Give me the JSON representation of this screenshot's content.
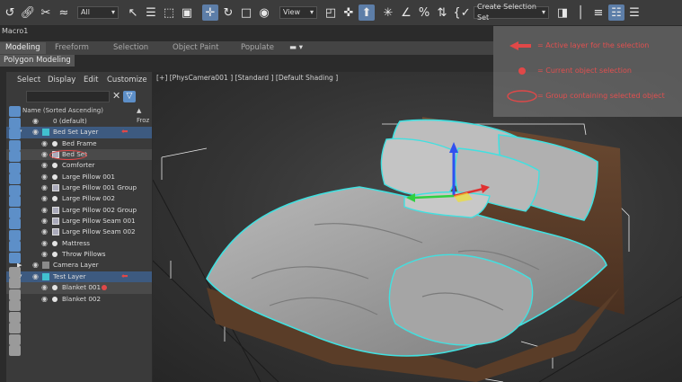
{
  "toolbar": {
    "filter_dropdown": "All",
    "view_dropdown": "View",
    "selection_set_dropdown": "Create Selection Set",
    "icons": [
      "undo-icon",
      "link-icon",
      "unlink-icon",
      "bind-spacewarp-icon",
      "select-object-icon",
      "select-by-name-icon",
      "rect-selection-icon",
      "window-crossing-icon",
      "move-icon",
      "rotate-icon",
      "scale-icon",
      "place-icon",
      "pivot-icon",
      "select-manipulate-icon",
      "keyboard-shortcut-icon",
      "snaps-icon",
      "angle-snap-icon",
      "percent-snap-icon",
      "spinner-snap-icon",
      "edit-named-sets-icon",
      "mirror-icon",
      "align-icon",
      "toggle-scene-explorer-icon",
      "toggle-layer-explorer-icon"
    ]
  },
  "macro": "Macro1",
  "ribbon": {
    "tabs": [
      "Modeling",
      "Freeform",
      "Selection",
      "Object Paint",
      "Populate"
    ],
    "active_tab": "Modeling",
    "subtab": "Polygon Modeling"
  },
  "explorer": {
    "menu": [
      "Select",
      "Display",
      "Edit",
      "Customize"
    ],
    "column_header": "Name (Sorted Ascending)",
    "frozen_header": "▲ Froz",
    "rows": [
      {
        "label": "0 (default)",
        "kind": "layer",
        "indent": 0
      },
      {
        "label": "Bed Set Layer",
        "kind": "layer",
        "indent": 0,
        "active": true
      },
      {
        "label": "Bed Frame",
        "kind": "object",
        "indent": 1
      },
      {
        "label": "Bed Set",
        "kind": "group",
        "indent": 1,
        "selected": true
      },
      {
        "label": "Comforter",
        "kind": "object",
        "indent": 1
      },
      {
        "label": "Large Pillow 001",
        "kind": "object",
        "indent": 1
      },
      {
        "label": "Large Pillow 001 Group",
        "kind": "group",
        "indent": 1
      },
      {
        "label": "Large Pillow 002",
        "kind": "object",
        "indent": 1
      },
      {
        "label": "Large Pillow 002 Group",
        "kind": "group",
        "indent": 1
      },
      {
        "label": "Large Pillow Seam 001",
        "kind": "group",
        "indent": 1
      },
      {
        "label": "Large Pillow Seam 002",
        "kind": "group",
        "indent": 1
      },
      {
        "label": "Mattress",
        "kind": "object",
        "indent": 1
      },
      {
        "label": "Throw Pillows",
        "kind": "object",
        "indent": 1
      },
      {
        "label": "Camera Layer",
        "kind": "layer",
        "indent": 0
      },
      {
        "label": "Test Layer",
        "kind": "layer",
        "indent": 0,
        "active": true
      },
      {
        "label": "Blanket 001",
        "kind": "object",
        "indent": 1,
        "selected": true
      },
      {
        "label": "Blanket 002",
        "kind": "object",
        "indent": 1
      }
    ]
  },
  "viewport": {
    "label": "[+] [PhysCamera001 ] [Standard ] [Default Shading ]"
  },
  "legend": {
    "items": [
      {
        "text": "= Active layer for the selection",
        "marker": "arrow"
      },
      {
        "text": "= Current object selection",
        "marker": "dot"
      },
      {
        "text": "= Group containing selected object",
        "marker": "ellipse"
      }
    ],
    "color": "#e04848"
  },
  "colors": {
    "accent": "#5d8fc8",
    "selection_outline": "#41e0e0",
    "annotation_red": "#e04848",
    "gizmo_red": "#e03030",
    "gizmo_green": "#30d040",
    "gizmo_blue": "#3050f0",
    "gizmo_yellow": "#f0e030"
  }
}
